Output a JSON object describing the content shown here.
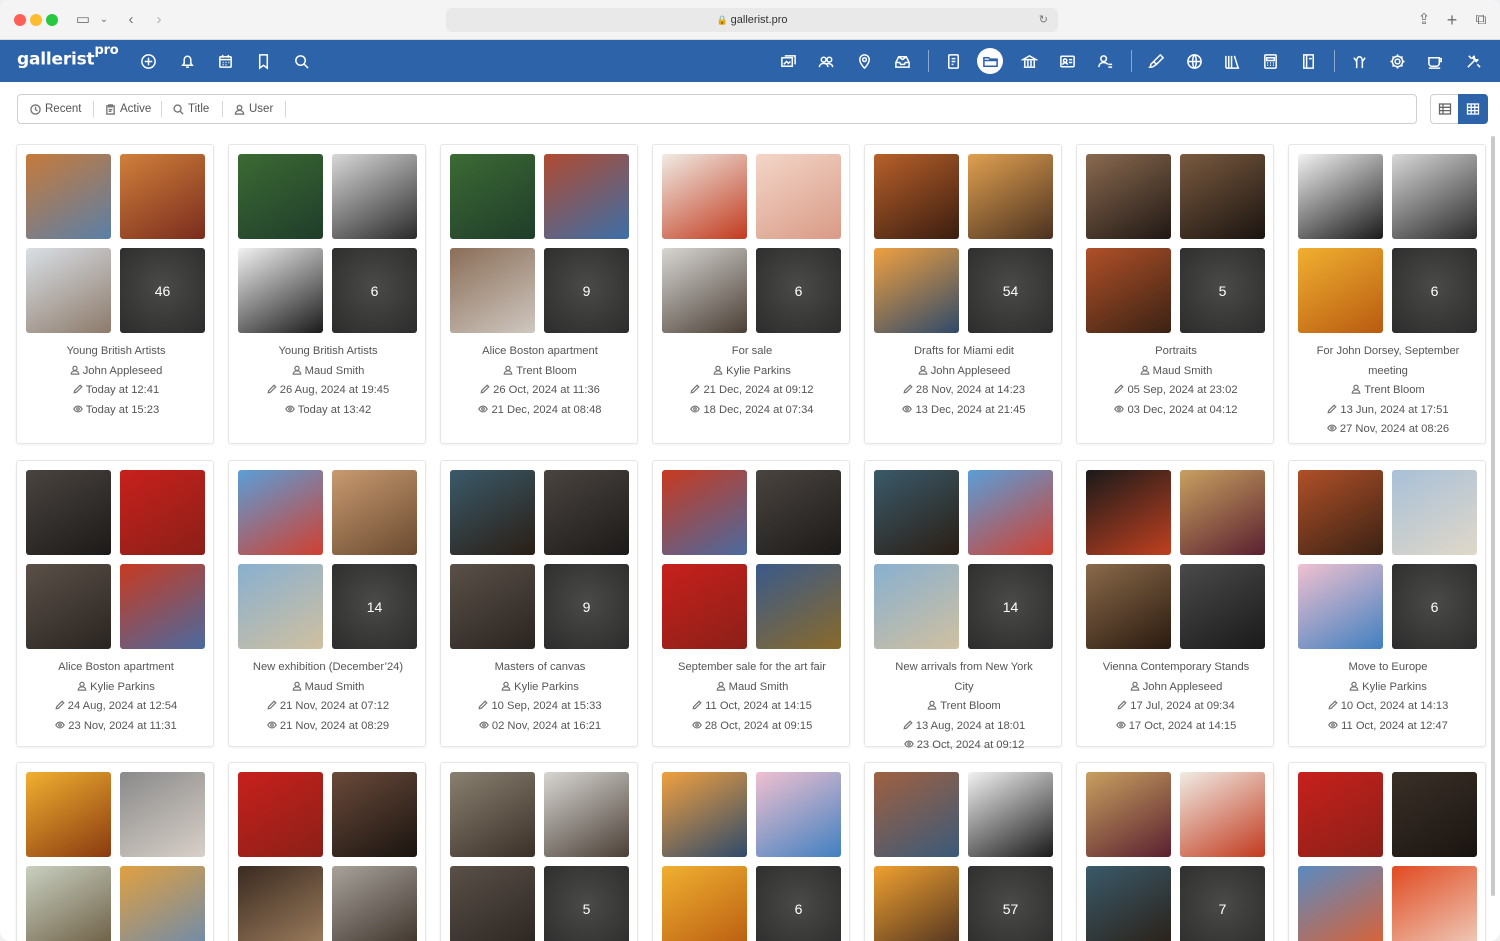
{
  "browser": {
    "url": "gallerist.pro"
  },
  "app": {
    "logo_main": "gallerist",
    "logo_sup": "pro",
    "brand_color": "#2d63a8"
  },
  "header_icons_left": [
    "add-icon",
    "bell-icon",
    "calendar-icon",
    "bookmark-icon",
    "search-icon"
  ],
  "header_icons_right": [
    "artworks-icon",
    "contacts-icon",
    "locations-icon",
    "inbox-icon",
    "documents-icon",
    "folder-icon",
    "institutions-icon",
    "id-card-icon",
    "user-settings-icon",
    "brush-icon",
    "globe-icon",
    "library-icon",
    "calculator-icon",
    "book-icon",
    "hands-icon",
    "gear-icon",
    "coffee-icon",
    "tools-icon"
  ],
  "filters": {
    "recent": "Recent",
    "active": "Active",
    "title": "Title",
    "user": "User"
  },
  "collections": [
    {
      "title": "Young British Artists",
      "user": "John Appleseed",
      "edited": "Today at 12:41",
      "viewed": "Today at 15:23",
      "count": "46",
      "thumbs": [
        "#c77a3a,#5a7fa8",
        "#d0803a,#7a2c1e",
        "#d9dfe6,#8d7a6a"
      ]
    },
    {
      "title": "Young British Artists",
      "user": "Maud Smith",
      "edited": "26 Aug, 2024 at 19:45",
      "viewed": "Today at 13:42",
      "count": "6",
      "thumbs": [
        "#3c6a34,#1f3d2a",
        "#d8d8d8,#2a2a2a",
        "#f2f2f2,#1a1a1a"
      ]
    },
    {
      "title": "Alice Boston apartment",
      "user": "Trent Bloom",
      "edited": "26 Oct, 2024 at 11:36",
      "viewed": "21 Dec, 2024 at 08:48",
      "count": "9",
      "thumbs": [
        "#3c6a34,#1f3d2a",
        "#b04a30,#3c6fa8",
        "#8a6e58,#cfc7c0"
      ]
    },
    {
      "title": "For sale",
      "user": "Kylie Parkins",
      "edited": "21 Dec, 2024 at 09:12",
      "viewed": "18 Dec, 2024 at 07:34",
      "count": "6",
      "thumbs": [
        "#f0ebe4,#c23a1e",
        "#f3d6c8,#d99a86",
        "#d8d6d2,#4a3f36"
      ]
    },
    {
      "title": "Drafts for Miami edit",
      "user": "John Appleseed",
      "edited": "28 Nov, 2024 at 14:23",
      "viewed": "13 Dec, 2024 at 21:45",
      "count": "54",
      "thumbs": [
        "#b8602a,#3a1d10",
        "#e0a050,#4a3120",
        "#f0a040,#2f4a6a"
      ]
    },
    {
      "title": "Portraits",
      "user": "Maud Smith",
      "edited": "05 Sep, 2024 at 23:02",
      "viewed": "03 Dec, 2024 at 04:12",
      "count": "5",
      "thumbs": [
        "#8a6a50,#201814",
        "#7a5a40,#1a1410",
        "#b05028,#3a2214"
      ]
    },
    {
      "title": "For John Dorsey, September meeting",
      "user": "Trent Bloom",
      "edited": "13 Jun, 2024 at 17:51",
      "viewed": "27 Nov, 2024 at 08:26",
      "count": "6",
      "thumbs": [
        "#f2f2f2,#1a1a1a",
        "#d8d8d8,#2a2a2a",
        "#f0b030,#b85a10"
      ]
    },
    {
      "title": "Alice Boston apartment",
      "user": "Kylie Parkins",
      "edited": "24 Aug, 2024 at 12:54",
      "viewed": "23 Nov, 2024 at 11:31",
      "count": "",
      "thumbs": [
        "#4a4440,#1c1a18",
        "#c8201c,#8a2018",
        "#5a5048,#2a2420",
        "#c83a20,#4a6aa0"
      ]
    },
    {
      "title": "New exhibition (December’24)",
      "user": "Maud Smith",
      "edited": "21 Nov, 2024 at 07:12",
      "viewed": "21 Nov, 2024 at 08:29",
      "count": "14",
      "thumbs": [
        "#5a9ed8,#d04030",
        "#c89a70,#6a4a30",
        "#88b0d0,#d0c0a0"
      ]
    },
    {
      "title": "Masters of canvas",
      "user": "Kylie Parkins",
      "edited": "10 Sep, 2024 at 15:33",
      "viewed": "02 Nov, 2024 at 16:21",
      "count": "9",
      "thumbs": [
        "#3a5a6a,#2a1e14",
        "#4a4440,#1c1a18",
        "#5a5048,#2a2420"
      ]
    },
    {
      "title": "September sale for the art fair",
      "user": "Maud Smith",
      "edited": "11 Oct, 2024 at 14:15",
      "viewed": "28 Oct, 2024 at 09:15",
      "count": "",
      "thumbs": [
        "#c83a20,#4a6aa0",
        "#4a4440,#1c1a18",
        "#c8201c,#8a2018",
        "#3a5a8a,#8a6a2a"
      ]
    },
    {
      "title": "New arrivals from New York City",
      "user": "Trent Bloom",
      "edited": "13 Aug, 2024 at 18:01",
      "viewed": "23 Oct, 2024 at 09:12",
      "count": "14",
      "thumbs": [
        "#3a5a6a,#2a1e14",
        "#5a9ed8,#d04030",
        "#88b0d0,#d0c0a0"
      ]
    },
    {
      "title": "Vienna Contemporary Stands",
      "user": "John Appleseed",
      "edited": "17 Jul, 2024 at 09:34",
      "viewed": "17 Oct, 2024 at 14:15",
      "count": "",
      "thumbs": [
        "#1a1a1a,#c04020",
        "#c8a060,#5a2030",
        "#8a6a4a,#2a1a10",
        "#4a4a4a,#1a1a1a"
      ]
    },
    {
      "title": "Move to Europe",
      "user": "Kylie Parkins",
      "edited": "10 Oct, 2024 at 14:13",
      "viewed": "11 Oct, 2024 at 12:47",
      "count": "6",
      "thumbs": [
        "#b05028,#3a2214",
        "#a8c0d8,#e0d8c8",
        "#f0c0d0,#4080c0"
      ]
    },
    {
      "title": "",
      "user": "",
      "edited": "",
      "viewed": "",
      "count": "",
      "thumbs": [
        "#f0b030,#8a3a10",
        "#8a8a8a,#d8d0c8",
        "#c8d0c0,#6a5a40",
        "#e0a040,#6a8ab0"
      ]
    },
    {
      "title": "",
      "user": "",
      "edited": "",
      "viewed": "",
      "count": "",
      "thumbs": [
        "#c8201c,#8a2018",
        "#6a4a3a,#1a1410",
        "#3a2a20,#a08060",
        "#a8a29a,#3a3028"
      ]
    },
    {
      "title": "",
      "user": "",
      "edited": "",
      "viewed": "",
      "count": "5",
      "thumbs": [
        "#8a8070,#3a3028",
        "#d8d6d2,#4a3f36",
        "#5a5048,#2a2420"
      ]
    },
    {
      "title": "",
      "user": "",
      "edited": "",
      "viewed": "",
      "count": "6",
      "thumbs": [
        "#f0a040,#2f4a6a",
        "#f0c0d0,#4080c0",
        "#f0b030,#b85a10"
      ]
    },
    {
      "title": "",
      "user": "",
      "edited": "",
      "viewed": "",
      "count": "57",
      "thumbs": [
        "#a06040,#3a5a7a",
        "#f2f2f2,#1a1a1a",
        "#f0a030,#4a3020"
      ]
    },
    {
      "title": "",
      "user": "",
      "edited": "",
      "viewed": "",
      "count": "7",
      "thumbs": [
        "#c8a060,#5a2030",
        "#f0ebe4,#c23a1e",
        "#3a5a6a,#2a1e14"
      ]
    },
    {
      "title": "",
      "user": "",
      "edited": "",
      "viewed": "",
      "count": "",
      "thumbs": [
        "#c8201c,#8a2018",
        "#3a3028,#1a1410",
        "#5a8ac0,#e06030",
        "#e04a20,#f0d0c0"
      ]
    }
  ]
}
